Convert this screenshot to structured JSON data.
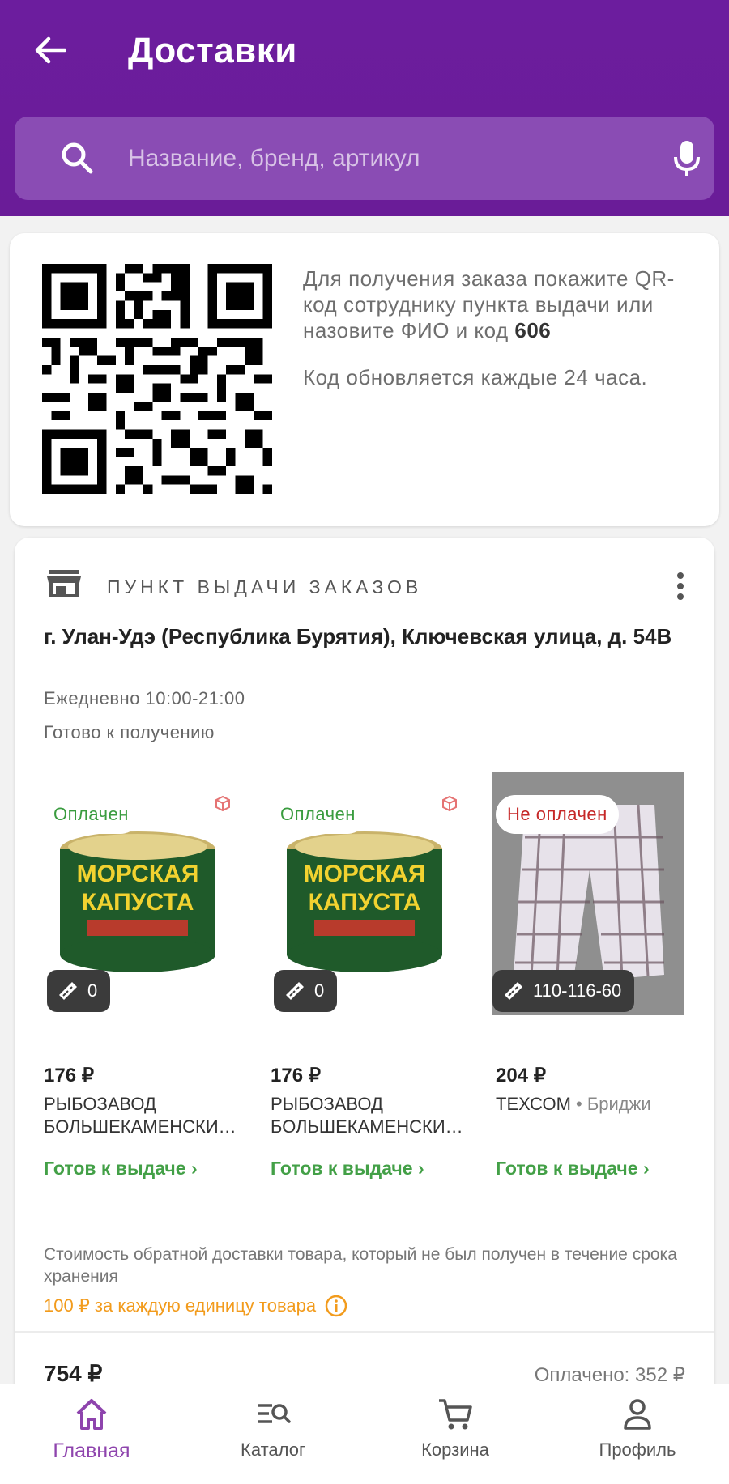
{
  "header": {
    "title": "Доставки",
    "search_placeholder": "Название, бренд, артикул"
  },
  "qr_card": {
    "instruction": "Для получения заказа покажите QR-код сотруднику пункта выдачи или назовите ФИО и код ",
    "code": "606",
    "note": "Код обновляется каждые 24 часа."
  },
  "pickup": {
    "label": "ПУНКТ ВЫДАЧИ ЗАКАЗОВ",
    "address": "г. Улан-Удэ (Республика Бурятия), Ключевская улица, д. 54В",
    "hours": "Ежедневно 10:00-21:00",
    "ready": "Готово к получению",
    "products": [
      {
        "badge": "Оплачен",
        "paid": true,
        "size": "0",
        "price": "176 ₽",
        "brand": "РЫБОЗАВОД БОЛЬШЕКАМЕНСКИ…",
        "subtitle": "",
        "status": "Готов к выдаче ›"
      },
      {
        "badge": "Оплачен",
        "paid": true,
        "size": "0",
        "price": "176 ₽",
        "brand": "РЫБОЗАВОД БОЛЬШЕКАМЕНСКИ…",
        "subtitle": "",
        "status": "Готов к выдаче ›"
      },
      {
        "badge": "Не оплачен",
        "paid": false,
        "size": "110-116-60",
        "price": "204 ₽",
        "brand": "ТЕХСОМ",
        "subtitle": " • Бриджи",
        "status": "Готов к выдаче ›"
      }
    ],
    "return_text": "Стоимость обратной доставки товара, который не был получен в течение срока хранения",
    "return_fee": "100 ₽ за каждую единицу товара",
    "total": "754 ₽",
    "paid_total": "Оплачено: 352 ₽"
  },
  "bottom_nav": [
    {
      "label": "Главная",
      "active": true
    },
    {
      "label": "Каталог",
      "active": false
    },
    {
      "label": "Корзина",
      "active": false
    },
    {
      "label": "Профиль",
      "active": false
    }
  ],
  "colors": {
    "header_bg": "#6a1b9a",
    "search_bg": "#8a4cb4",
    "paid_green": "#43a047",
    "unpaid_red": "#c62828",
    "fee_orange": "#f29b1c",
    "nav_active": "#8e44ad"
  }
}
